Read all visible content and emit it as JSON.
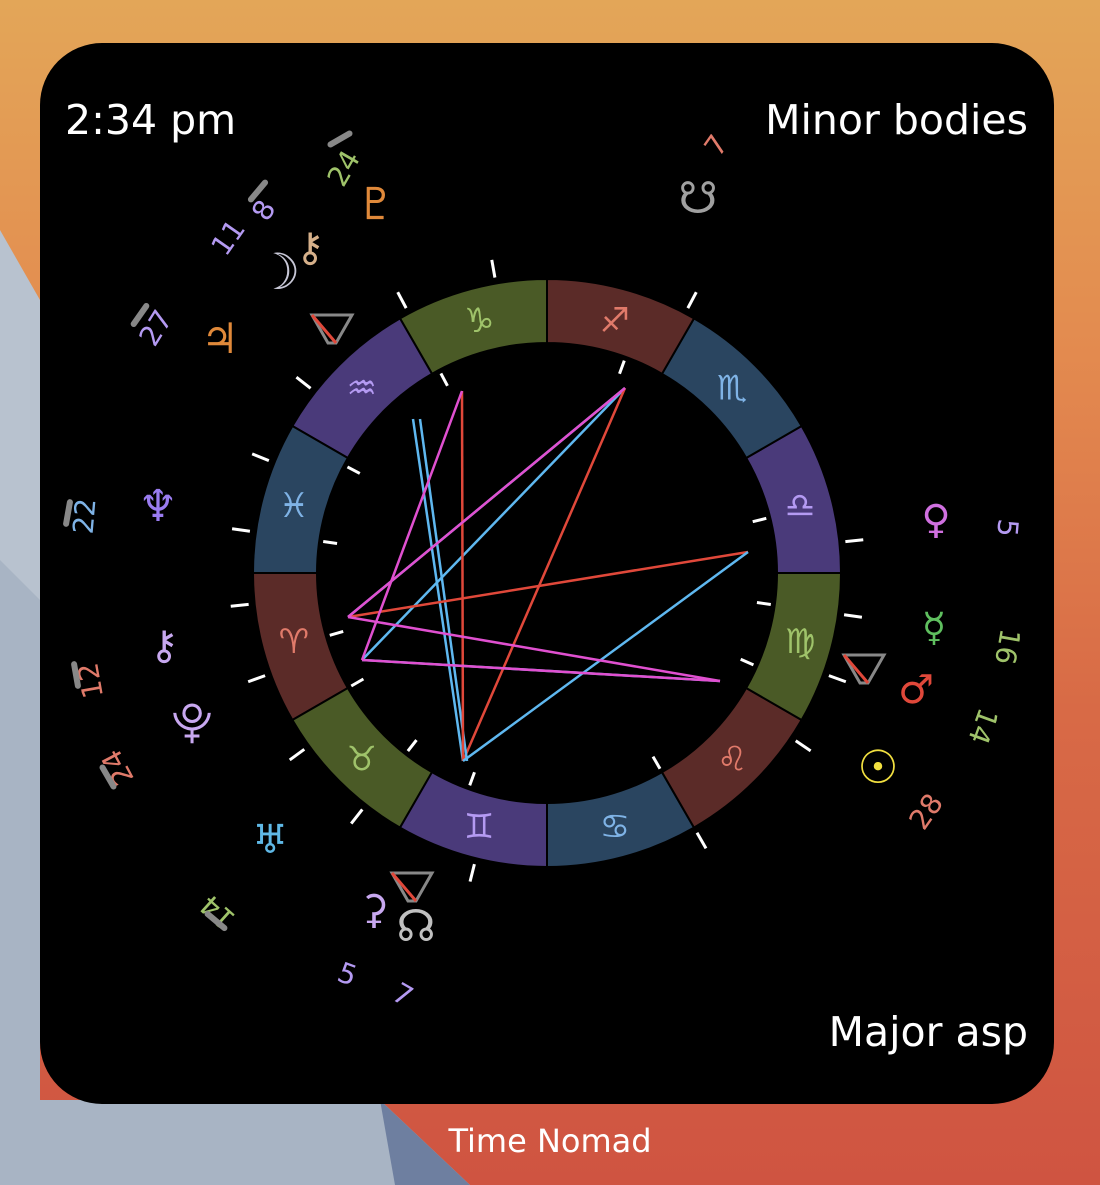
{
  "widget": {
    "time": "2:34 pm",
    "top_right_label": "Minor bodies",
    "bottom_right_label": "Major asp"
  },
  "app_name": "Time Nomad",
  "zodiac": [
    {
      "name": "aries",
      "glyph": "♈",
      "color": "#e07a6a",
      "fill": "#5b2b28"
    },
    {
      "name": "taurus",
      "glyph": "♉",
      "color": "#9fc36a",
      "fill": "#4a5a26"
    },
    {
      "name": "gemini",
      "glyph": "♊",
      "color": "#b49af2",
      "fill": "#4a3a7a"
    },
    {
      "name": "cancer",
      "glyph": "♋",
      "color": "#7fb3e6",
      "fill": "#2a4560"
    },
    {
      "name": "leo",
      "glyph": "♌",
      "color": "#e07a6a",
      "fill": "#5b2b28"
    },
    {
      "name": "virgo",
      "glyph": "♍",
      "color": "#9fc36a",
      "fill": "#4a5a26"
    },
    {
      "name": "libra",
      "glyph": "♎",
      "color": "#b49af2",
      "fill": "#4a3a7a"
    },
    {
      "name": "scorpio",
      "glyph": "♏",
      "color": "#7fb3e6",
      "fill": "#2a4560"
    },
    {
      "name": "sagittarius",
      "glyph": "♐",
      "color": "#e07a6a",
      "fill": "#5b2b28"
    },
    {
      "name": "capricorn",
      "glyph": "♑",
      "color": "#9fc36a",
      "fill": "#4a5a26"
    },
    {
      "name": "aquarius",
      "glyph": "♒",
      "color": "#b49af2",
      "fill": "#4a3a7a"
    },
    {
      "name": "pisces",
      "glyph": "♓",
      "color": "#7fb3e6",
      "fill": "#2a4560"
    }
  ],
  "bodies": [
    {
      "name": "pluto",
      "glyph": "♇",
      "degree": "24",
      "color": "#e0893a",
      "degree_color": "#9fc36a"
    },
    {
      "name": "chiron-alt",
      "glyph": "⚷",
      "degree": "8",
      "color": "#d6b08a",
      "degree_color": "#b49af2"
    },
    {
      "name": "moon",
      "glyph": "☽",
      "degree": "11",
      "color": "#c7c7d6",
      "degree_color": "#b49af2"
    },
    {
      "name": "jupiter",
      "glyph": "♃",
      "degree": "27",
      "color": "#e0893a",
      "degree_color": "#b49af2"
    },
    {
      "name": "neptune",
      "glyph": "♆",
      "degree": "22",
      "color": "#9a7cf0",
      "degree_color": "#7fb3e6"
    },
    {
      "name": "chiron",
      "glyph": "⚷",
      "degree": "12",
      "color": "#c8a8f0",
      "degree_color": "#e07a6a"
    },
    {
      "name": "pluto-alt",
      "glyph": "⯓",
      "degree": "24",
      "color": "#c8a8f0",
      "degree_color": "#e07a6a"
    },
    {
      "name": "uranus",
      "glyph": "♅",
      "degree": "14",
      "color": "#5fb8e6",
      "degree_color": "#9fc36a"
    },
    {
      "name": "ceres",
      "glyph": "⚳",
      "degree": "5",
      "color": "#c8a8f0",
      "degree_color": "#b49af2"
    },
    {
      "name": "north-node",
      "glyph": "☊",
      "degree": "7",
      "color": "#c0c0c0",
      "degree_color": "#b49af2"
    },
    {
      "name": "south-node",
      "glyph": "☋",
      "degree": "7",
      "color": "#a0a0a0",
      "degree_color": "#e07a6a"
    },
    {
      "name": "venus",
      "glyph": "♀",
      "degree": "5",
      "color": "#d070e0",
      "degree_color": "#b49af2"
    },
    {
      "name": "mercury",
      "glyph": "☿",
      "degree": "16",
      "color": "#5fbf5f",
      "degree_color": "#9fc36a"
    },
    {
      "name": "mars",
      "glyph": "♂",
      "degree": "14",
      "color": "#e0483a",
      "degree_color": "#9fc36a"
    },
    {
      "name": "sun",
      "glyph": "☉",
      "degree": "28",
      "color": "#f2e040",
      "degree_color": "#e07a6a"
    }
  ],
  "aspects": [
    {
      "type": "trine",
      "color": "#5fb8f0"
    },
    {
      "type": "square",
      "color": "#e0483a"
    },
    {
      "type": "opposition",
      "color": "#e050d0"
    }
  ]
}
